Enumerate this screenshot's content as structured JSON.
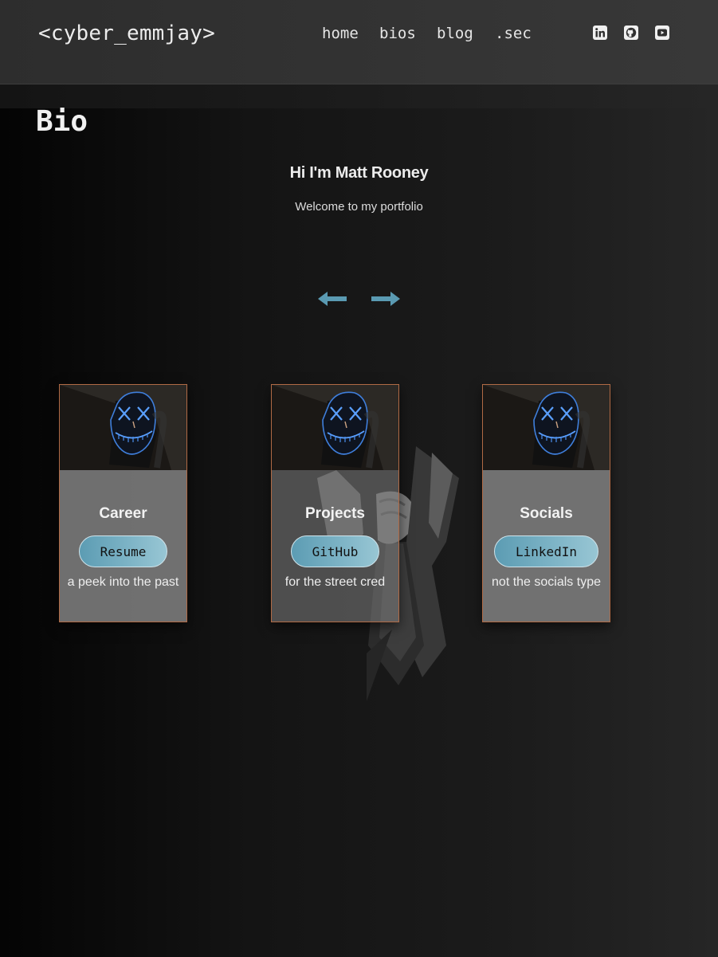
{
  "header": {
    "brand": "<cyber_emmjay>",
    "nav": [
      {
        "label": "home"
      },
      {
        "label": "bios"
      },
      {
        "label": "blog"
      },
      {
        "label": ".sec"
      }
    ],
    "social_icons": [
      "linkedin-icon",
      "github-icon",
      "youtube-icon"
    ]
  },
  "page": {
    "title": "Bio"
  },
  "hero": {
    "heading": "Hi I'm Matt Rooney",
    "subheading": "Welcome to my portfolio",
    "prev_icon": "arrow-left-icon",
    "next_icon": "arrow-right-icon"
  },
  "cards": [
    {
      "title": "Career",
      "button": "Resume",
      "description": "a peek into the past"
    },
    {
      "title": "Projects",
      "button": "GitHub",
      "description": "for the street cred"
    },
    {
      "title": "Socials",
      "button": "LinkedIn",
      "description": "not the socials type"
    }
  ],
  "colors": {
    "accent": "#5c9cb3",
    "card_border": "#b06a45",
    "card_bg": "#787878",
    "header_bg": "#333333"
  }
}
